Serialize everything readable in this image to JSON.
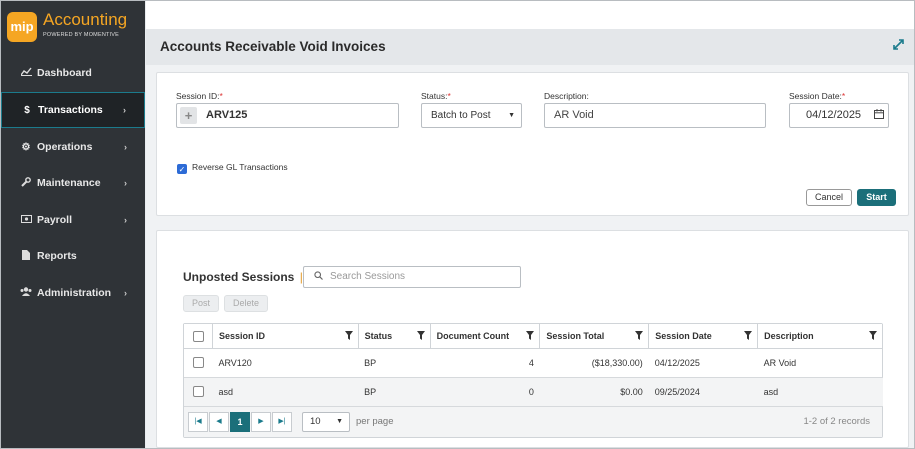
{
  "app": {
    "logo_text": "mip",
    "product_name": "Accounting",
    "tagline": "POWERED BY MOMENTIVE"
  },
  "sidebar": {
    "items": [
      {
        "label": "Dashboard",
        "icon": "chart-line-icon"
      },
      {
        "label": "Transactions",
        "icon": "dollar-icon",
        "active": true
      },
      {
        "label": "Operations",
        "icon": "gears-icon"
      },
      {
        "label": "Maintenance",
        "icon": "wrench-icon"
      },
      {
        "label": "Payroll",
        "icon": "money-icon"
      },
      {
        "label": "Reports",
        "icon": "file-icon"
      },
      {
        "label": "Administration",
        "icon": "users-icon"
      }
    ]
  },
  "page": {
    "title": "Accounts Receivable Void Invoices"
  },
  "form": {
    "session_id_label": "Session ID:",
    "session_id_value": "ARV125",
    "status_label": "Status:",
    "status_value": "Batch to Post",
    "description_label": "Description:",
    "description_value": "AR Void",
    "session_date_label": "Session Date:",
    "session_date_value": "04/12/2025",
    "required_mark": "*",
    "reverse_gl_label": "Reverse GL Transactions",
    "reverse_gl_checked": true,
    "cancel_label": "Cancel",
    "start_label": "Start"
  },
  "sessions": {
    "title": "Unposted Sessions",
    "separator": "|",
    "search_placeholder": "Search Sessions",
    "post_label": "Post",
    "delete_label": "Delete",
    "columns": [
      "Session ID",
      "Status",
      "Document Count",
      "Session Total",
      "Session Date",
      "Description"
    ],
    "rows": [
      {
        "session_id": "ARV120",
        "status": "BP",
        "document_count": "4",
        "session_total": "($18,330.00)",
        "session_date": "04/12/2025",
        "description": "AR Void"
      },
      {
        "session_id": "asd",
        "status": "BP",
        "document_count": "0",
        "session_total": "$0.00",
        "session_date": "09/25/2024",
        "description": "asd"
      }
    ],
    "pager": {
      "current_page": "1",
      "page_size": "10",
      "per_page_label": "per page",
      "records_text": "1-2 of 2 records"
    }
  }
}
